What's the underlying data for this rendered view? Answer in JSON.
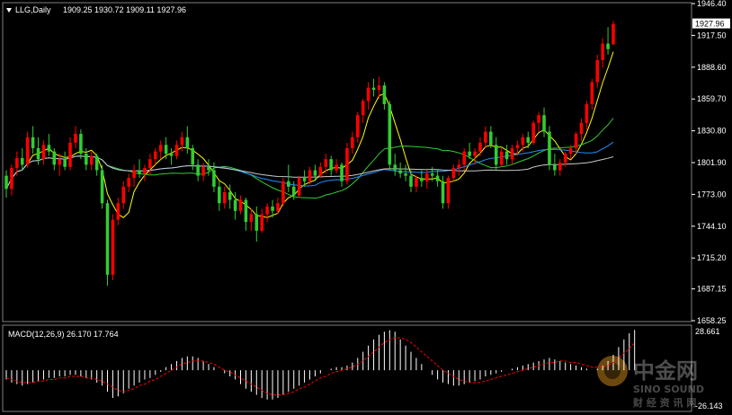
{
  "header": {
    "symbol": "LLG,Daily",
    "ohlc": "1909.25 1930.72 1909.11 1927.96"
  },
  "macd_header": {
    "label": "MACD(12,26,9) 26.170 17.764"
  },
  "price_axis": {
    "ticks": [
      "1946.40",
      "1917.50",
      "1888.60",
      "1859.70",
      "1830.80",
      "1801.90",
      "1773.00",
      "1744.10",
      "1715.20",
      "1687.15",
      "1658.25"
    ],
    "current_price": "1927.96"
  },
  "macd_axis": {
    "top": "28.661",
    "bottom": "-26.143"
  },
  "watermark": {
    "brand": "中金网",
    "latin": "SINO SOUND",
    "tagline": "财 经 资 讯 网"
  },
  "colors": {
    "background": "#000000",
    "bull": "#ff0000",
    "bear": "#32cd32",
    "ma_fast": "#ffff00",
    "ma_mid": "#32cd32",
    "ma_slow": "#1e90ff",
    "ma_long": "#c8c8c8",
    "macd_hist": "#ffffff",
    "macd_signal": "#ff0000"
  },
  "chart_data": {
    "type": "candlestick",
    "price_range": [
      1658.25,
      1946.4
    ],
    "macd_range": [
      -26.143,
      28.661
    ],
    "candles": [
      [
        1790,
        1795,
        1770,
        1778
      ],
      [
        1778,
        1800,
        1772,
        1797
      ],
      [
        1797,
        1812,
        1790,
        1806
      ],
      [
        1806,
        1815,
        1795,
        1800
      ],
      [
        1800,
        1830,
        1797,
        1825
      ],
      [
        1825,
        1835,
        1810,
        1815
      ],
      [
        1815,
        1825,
        1800,
        1805
      ],
      [
        1805,
        1822,
        1800,
        1818
      ],
      [
        1818,
        1828,
        1808,
        1812
      ],
      [
        1812,
        1815,
        1795,
        1800
      ],
      [
        1800,
        1810,
        1790,
        1805
      ],
      [
        1805,
        1812,
        1795,
        1798
      ],
      [
        1798,
        1825,
        1795,
        1820
      ],
      [
        1820,
        1835,
        1815,
        1828
      ],
      [
        1828,
        1832,
        1805,
        1810
      ],
      [
        1810,
        1815,
        1795,
        1800
      ],
      [
        1800,
        1812,
        1795,
        1808
      ],
      [
        1808,
        1810,
        1790,
        1795
      ],
      [
        1795,
        1800,
        1760,
        1765
      ],
      [
        1765,
        1768,
        1690,
        1700
      ],
      [
        1700,
        1755,
        1695,
        1750
      ],
      [
        1750,
        1770,
        1745,
        1765
      ],
      [
        1765,
        1785,
        1760,
        1780
      ],
      [
        1780,
        1792,
        1775,
        1788
      ],
      [
        1788,
        1800,
        1780,
        1795
      ],
      [
        1795,
        1805,
        1788,
        1792
      ],
      [
        1792,
        1800,
        1785,
        1797
      ],
      [
        1797,
        1810,
        1790,
        1805
      ],
      [
        1805,
        1815,
        1800,
        1812
      ],
      [
        1812,
        1822,
        1805,
        1818
      ],
      [
        1818,
        1825,
        1805,
        1810
      ],
      [
        1810,
        1815,
        1800,
        1808
      ],
      [
        1808,
        1822,
        1805,
        1818
      ],
      [
        1818,
        1830,
        1812,
        1825
      ],
      [
        1825,
        1835,
        1810,
        1815
      ],
      [
        1815,
        1818,
        1795,
        1800
      ],
      [
        1800,
        1805,
        1785,
        1790
      ],
      [
        1790,
        1802,
        1785,
        1798
      ],
      [
        1798,
        1805,
        1790,
        1795
      ],
      [
        1795,
        1802,
        1775,
        1780
      ],
      [
        1780,
        1785,
        1758,
        1765
      ],
      [
        1765,
        1780,
        1760,
        1775
      ],
      [
        1775,
        1782,
        1760,
        1768
      ],
      [
        1768,
        1775,
        1750,
        1758
      ],
      [
        1758,
        1772,
        1755,
        1768
      ],
      [
        1768,
        1770,
        1740,
        1748
      ],
      [
        1748,
        1760,
        1740,
        1755
      ],
      [
        1755,
        1762,
        1730,
        1740
      ],
      [
        1740,
        1760,
        1738,
        1755
      ],
      [
        1755,
        1765,
        1748,
        1762
      ],
      [
        1762,
        1768,
        1752,
        1758
      ],
      [
        1758,
        1770,
        1755,
        1765
      ],
      [
        1765,
        1788,
        1762,
        1785
      ],
      [
        1785,
        1800,
        1775,
        1780
      ],
      [
        1780,
        1785,
        1768,
        1772
      ],
      [
        1772,
        1790,
        1770,
        1788
      ],
      [
        1788,
        1795,
        1780,
        1785
      ],
      [
        1785,
        1798,
        1782,
        1795
      ],
      [
        1795,
        1800,
        1785,
        1790
      ],
      [
        1790,
        1802,
        1788,
        1798
      ],
      [
        1798,
        1810,
        1792,
        1805
      ],
      [
        1805,
        1808,
        1790,
        1795
      ],
      [
        1795,
        1805,
        1792,
        1800
      ],
      [
        1800,
        1802,
        1780,
        1785
      ],
      [
        1785,
        1820,
        1782,
        1815
      ],
      [
        1815,
        1830,
        1810,
        1825
      ],
      [
        1825,
        1848,
        1820,
        1845
      ],
      [
        1845,
        1860,
        1838,
        1858
      ],
      [
        1858,
        1875,
        1850,
        1870
      ],
      [
        1870,
        1878,
        1862,
        1868
      ],
      [
        1868,
        1880,
        1860,
        1872
      ],
      [
        1872,
        1875,
        1850,
        1855
      ],
      [
        1855,
        1858,
        1795,
        1800
      ],
      [
        1800,
        1810,
        1790,
        1795
      ],
      [
        1795,
        1802,
        1788,
        1792
      ],
      [
        1792,
        1800,
        1785,
        1790
      ],
      [
        1790,
        1795,
        1775,
        1780
      ],
      [
        1780,
        1790,
        1775,
        1788
      ],
      [
        1788,
        1795,
        1780,
        1785
      ],
      [
        1785,
        1795,
        1778,
        1792
      ],
      [
        1792,
        1798,
        1785,
        1790
      ],
      [
        1790,
        1796,
        1780,
        1785
      ],
      [
        1785,
        1790,
        1760,
        1765
      ],
      [
        1765,
        1790,
        1760,
        1788
      ],
      [
        1788,
        1800,
        1785,
        1797
      ],
      [
        1797,
        1805,
        1790,
        1800
      ],
      [
        1800,
        1815,
        1795,
        1812
      ],
      [
        1812,
        1820,
        1805,
        1808
      ],
      [
        1808,
        1815,
        1800,
        1812
      ],
      [
        1812,
        1825,
        1808,
        1820
      ],
      [
        1820,
        1835,
        1815,
        1830
      ],
      [
        1830,
        1835,
        1815,
        1818
      ],
      [
        1818,
        1825,
        1795,
        1800
      ],
      [
        1800,
        1815,
        1798,
        1812
      ],
      [
        1812,
        1818,
        1800,
        1805
      ],
      [
        1805,
        1818,
        1800,
        1815
      ],
      [
        1815,
        1822,
        1808,
        1818
      ],
      [
        1818,
        1828,
        1812,
        1825
      ],
      [
        1825,
        1830,
        1815,
        1820
      ],
      [
        1820,
        1840,
        1818,
        1838
      ],
      [
        1838,
        1848,
        1830,
        1845
      ],
      [
        1845,
        1852,
        1825,
        1830
      ],
      [
        1830,
        1835,
        1795,
        1800
      ],
      [
        1800,
        1810,
        1790,
        1795
      ],
      [
        1795,
        1805,
        1790,
        1802
      ],
      [
        1802,
        1812,
        1798,
        1810
      ],
      [
        1810,
        1818,
        1805,
        1815
      ],
      [
        1815,
        1830,
        1810,
        1828
      ],
      [
        1828,
        1842,
        1822,
        1838
      ],
      [
        1838,
        1858,
        1832,
        1855
      ],
      [
        1855,
        1878,
        1850,
        1875
      ],
      [
        1875,
        1900,
        1870,
        1895
      ],
      [
        1895,
        1915,
        1888,
        1910
      ],
      [
        1910,
        1925,
        1900,
        1905
      ],
      [
        1909.25,
        1930.72,
        1909.11,
        1927.96
      ]
    ],
    "macd_hist": [
      -6,
      -8,
      -9,
      -10,
      -9,
      -8,
      -7,
      -6,
      -5,
      -5,
      -4,
      -4,
      -3,
      -3,
      -4,
      -5,
      -6,
      -8,
      -10,
      -14,
      -18,
      -17,
      -15,
      -12,
      -10,
      -8,
      -6,
      -5,
      -3,
      -1,
      2,
      4,
      6,
      8,
      9,
      9,
      8,
      6,
      4,
      2,
      0,
      -2,
      -4,
      -6,
      -9,
      -12,
      -14,
      -16,
      -18,
      -19,
      -19,
      -18,
      -16,
      -14,
      -12,
      -10,
      -8,
      -6,
      -4,
      -2,
      0,
      1,
      2,
      2,
      3,
      5,
      8,
      12,
      16,
      20,
      23,
      25,
      26,
      25,
      20,
      16,
      12,
      8,
      4,
      0,
      -3,
      -6,
      -8,
      -9,
      -10,
      -10,
      -9,
      -8,
      -7,
      -6,
      -4,
      -3,
      -2,
      -1,
      0,
      1,
      2,
      3,
      4,
      5,
      6,
      7,
      8,
      7,
      6,
      5,
      4,
      3,
      2,
      1,
      0,
      1,
      3,
      6,
      10,
      15,
      20,
      24,
      26.17
    ],
    "macd_signal": [
      -5,
      -6,
      -7,
      -8,
      -8,
      -8,
      -7,
      -7,
      -6,
      -6,
      -5,
      -5,
      -4,
      -4,
      -4,
      -5,
      -5,
      -6,
      -7,
      -9,
      -11,
      -13,
      -14,
      -13,
      -12,
      -10,
      -9,
      -7,
      -6,
      -4,
      -2,
      0,
      2,
      4,
      5,
      6,
      6,
      6,
      5,
      4,
      2,
      0,
      -1,
      -3,
      -5,
      -7,
      -9,
      -11,
      -13,
      -15,
      -16,
      -16,
      -16,
      -15,
      -14,
      -12,
      -11,
      -9,
      -7,
      -5,
      -4,
      -2,
      -1,
      0,
      1,
      2,
      4,
      6,
      9,
      12,
      15,
      18,
      20,
      21,
      21,
      20,
      18,
      15,
      12,
      9,
      6,
      3,
      0,
      -2,
      -4,
      -6,
      -7,
      -8,
      -8,
      -8,
      -7,
      -6,
      -5,
      -4,
      -3,
      -2,
      -1,
      0,
      1,
      2,
      3,
      4,
      5,
      5,
      6,
      6,
      5,
      5,
      4,
      3,
      2,
      2,
      2,
      3,
      5,
      8,
      11,
      14,
      17.764
    ]
  }
}
